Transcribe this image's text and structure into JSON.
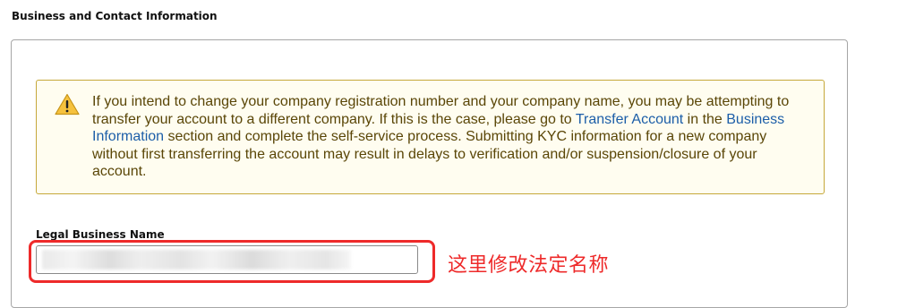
{
  "section": {
    "title": "Business and Contact Information"
  },
  "alert": {
    "icon": "warning-icon",
    "text_part1": "If you intend to change your company registration number and your company name, you may be attempting to transfer your account to a different company. If this is the case, please go to ",
    "link1": "Transfer Account",
    "text_part2": " in the ",
    "link2": "Business Information",
    "text_part3": " section and complete the self-service process. Submitting KYC information for a new company without first transferring the account may result in delays to verification and/or suspension/closure of your account.",
    "border_color": "#c6a83a",
    "background_color": "#fffdf0",
    "text_color": "#5a4607",
    "link_color": "#1c5ea8"
  },
  "legal_business_name": {
    "label": "Legal Business Name",
    "value": "",
    "value_obscured": true
  },
  "annotation": {
    "text": "这里修改法定名称",
    "color": "#ee2a2a"
  }
}
